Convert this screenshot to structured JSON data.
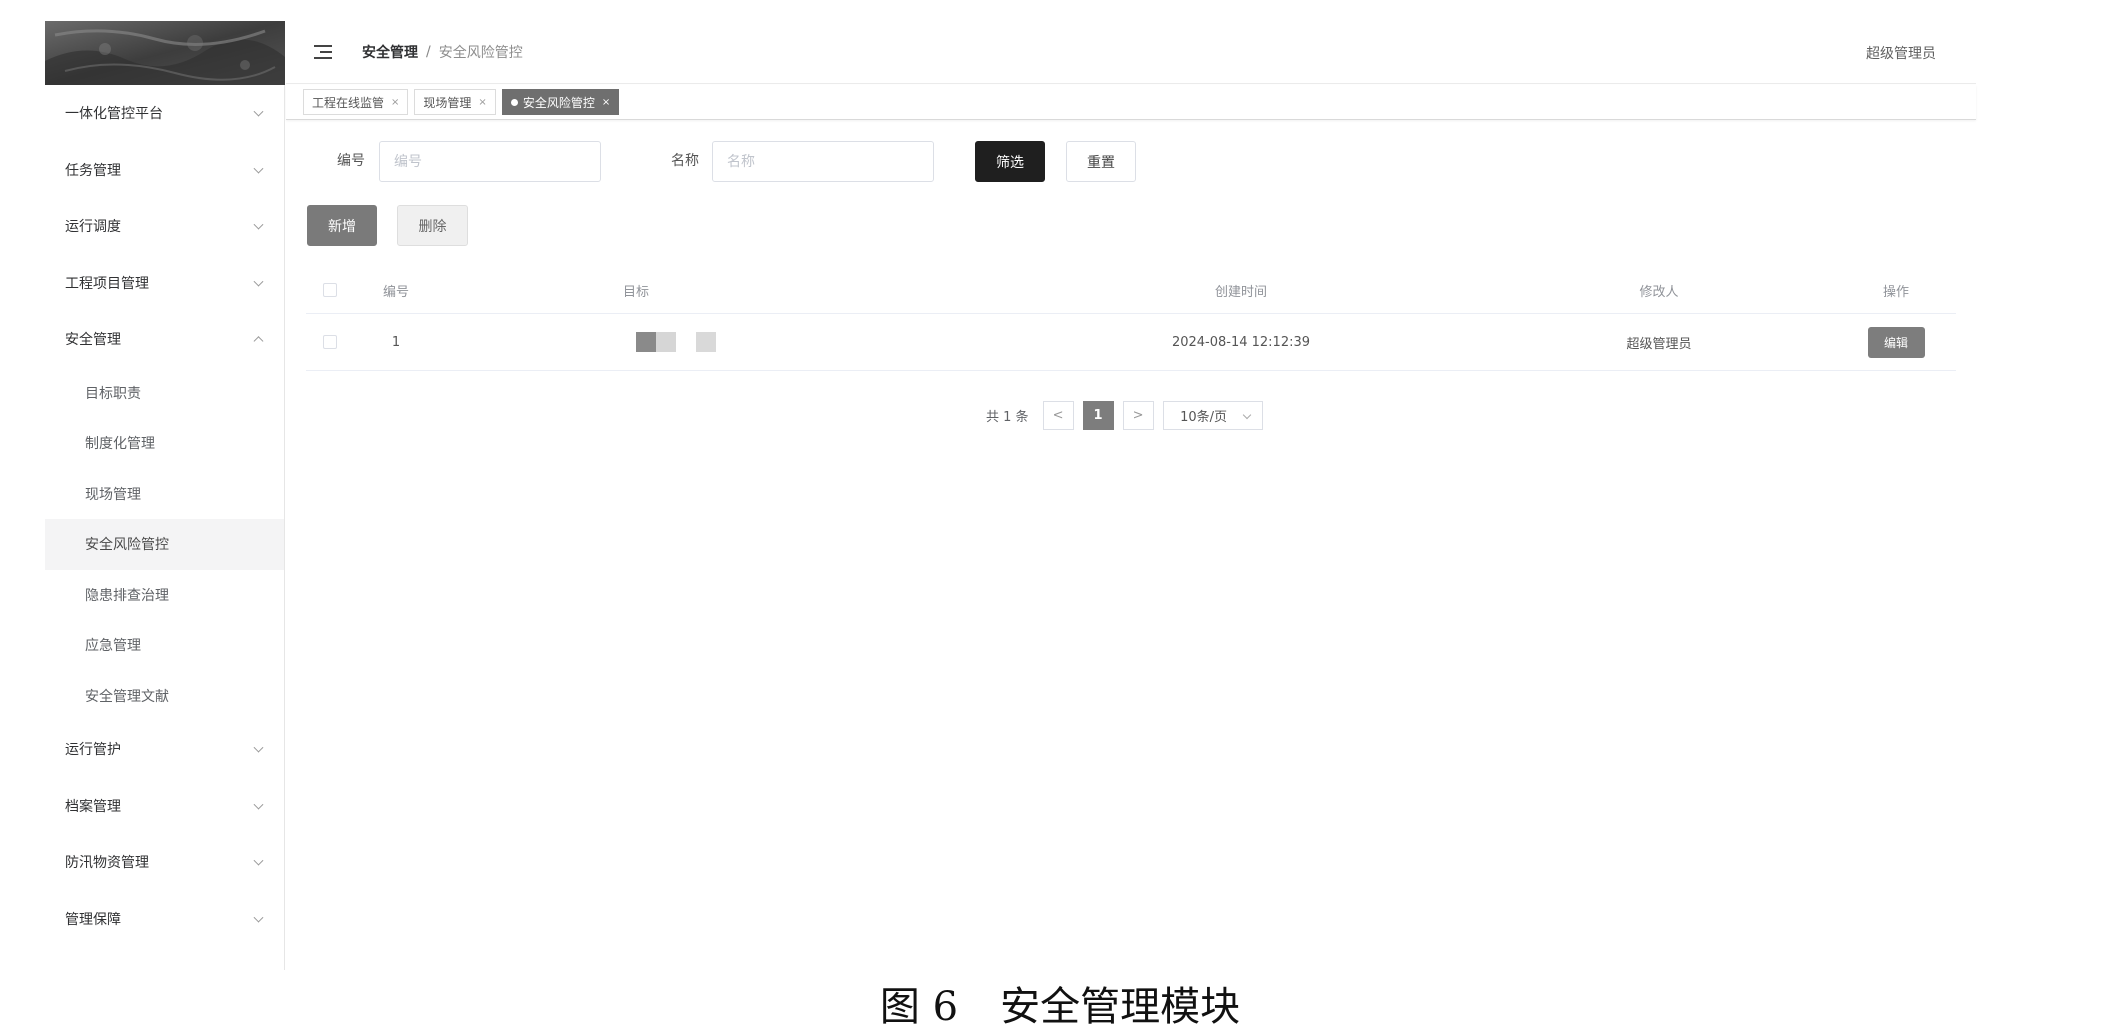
{
  "header": {
    "breadcrumb_root": "安全管理",
    "breadcrumb_sep": "/",
    "breadcrumb_current": "安全风险管控",
    "user": "超级管理员"
  },
  "sidebar": {
    "top_items": [
      {
        "label": "一体化管控平台"
      },
      {
        "label": "任务管理"
      },
      {
        "label": "运行调度"
      },
      {
        "label": "工程项目管理"
      }
    ],
    "expanded": {
      "label": "安全管理",
      "children": [
        {
          "label": "目标职责"
        },
        {
          "label": "制度化管理"
        },
        {
          "label": "现场管理"
        },
        {
          "label": "安全风险管控",
          "active": true
        },
        {
          "label": "隐患排查治理"
        },
        {
          "label": "应急管理"
        },
        {
          "label": "安全管理文献"
        }
      ]
    },
    "bottom_items": [
      {
        "label": "运行管护"
      },
      {
        "label": "档案管理"
      },
      {
        "label": "防汛物资管理"
      },
      {
        "label": "管理保障"
      }
    ]
  },
  "tags": [
    {
      "label": "工程在线监管",
      "close": "×"
    },
    {
      "label": "现场管理",
      "close": "×"
    },
    {
      "label": "安全风险管控",
      "close": "×",
      "active": true
    }
  ],
  "filters": {
    "code_label": "编号",
    "code_placeholder": "编号",
    "name_label": "名称",
    "name_placeholder": "名称",
    "filter_button": "筛选",
    "reset_button": "重置"
  },
  "actions": {
    "add_button": "新增",
    "delete_button": "删除"
  },
  "table": {
    "columns": [
      "编号",
      "目标",
      "创建时间",
      "修改人",
      "操作"
    ],
    "rows": [
      {
        "code": "1",
        "created": "2024-08-14 12:12:39",
        "modifier": "超级管理员",
        "action": "编辑"
      }
    ]
  },
  "pagination": {
    "total": "共 1 条",
    "prev": "<",
    "current": "1",
    "next": ">",
    "page_size": "10条/页"
  },
  "caption": {
    "number": "图 6",
    "title": "安全管理模块"
  }
}
